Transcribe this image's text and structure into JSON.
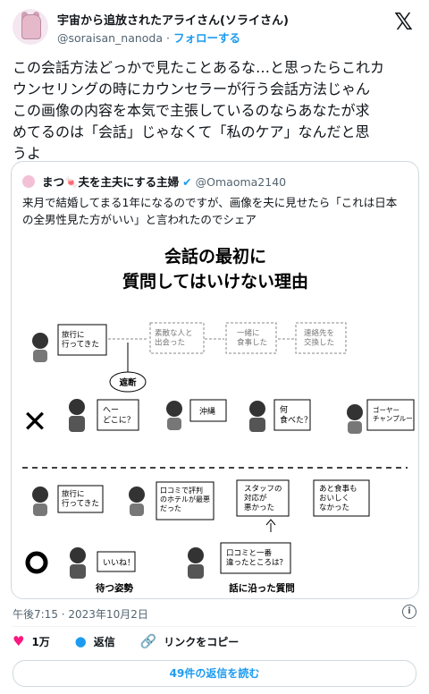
{
  "author": {
    "display_name": "宇宙から追放されたアライさん(ソライさん)",
    "handle": "@soraisan_nanoda",
    "separator": "·",
    "follow_label": "フォローする"
  },
  "brand_icon": "x-logo",
  "tweet_text": "この会話方法どっかで見たことあるな…と思ったらこれカ\nウンセリングの時にカウンセラーが行う会話方法じゃん\nこの画像の内容を本気で主張しているのならあなたが求\nめてるのは「会話」じゃなくて「私のケア」なんだと思\nうよ",
  "quoted": {
    "display_name": "まつ🍬夫を主夫にする主婦",
    "handle": "@Omaoma2140",
    "text": "来月で結婚してまる1年になるのですが、画像を夫に見せたら「これは日本の全男性見た方がいい」と言われたのでシェア",
    "illustration": {
      "title_line1": "会話の最初に",
      "title_line2": "質問してはいけない理由",
      "bad_mark": "✕",
      "good_mark": "○",
      "bad": {
        "woman_start": "旅行に\n行ってきた",
        "man_interrupt": "へー\nどこに？",
        "cut_label": "遮断",
        "dotted_bubbles": [
          "素敵な人と\n出会った",
          "一緒に\n食事した",
          "連絡先を\n交換した"
        ],
        "woman_answer1": "沖縄",
        "man_q2": "何\n食べた？",
        "woman_answer2": "ゴーヤー\nチャンプルー"
      },
      "good": {
        "woman_start": "旅行に\n行ってきた",
        "woman_line2": "口コミで評判\nのホテルが最悪\nだった",
        "woman_line3": "スタッフの\n対応が\n悪かった",
        "woman_line4": "あと食事も\nおいしく\nなかった",
        "man_reply": "いいね！",
        "man_q": "口コミと一番\n違ったところは？",
        "label_wait": "待つ姿勢",
        "label_follow": "話に沿った質問"
      }
    }
  },
  "timestamp": "午後7:15 · 2023年10月2日",
  "actions": {
    "likes": "1万",
    "reply": "返信",
    "copy_link": "リンクをコピー"
  },
  "read_replies": "49件の返信を読む"
}
